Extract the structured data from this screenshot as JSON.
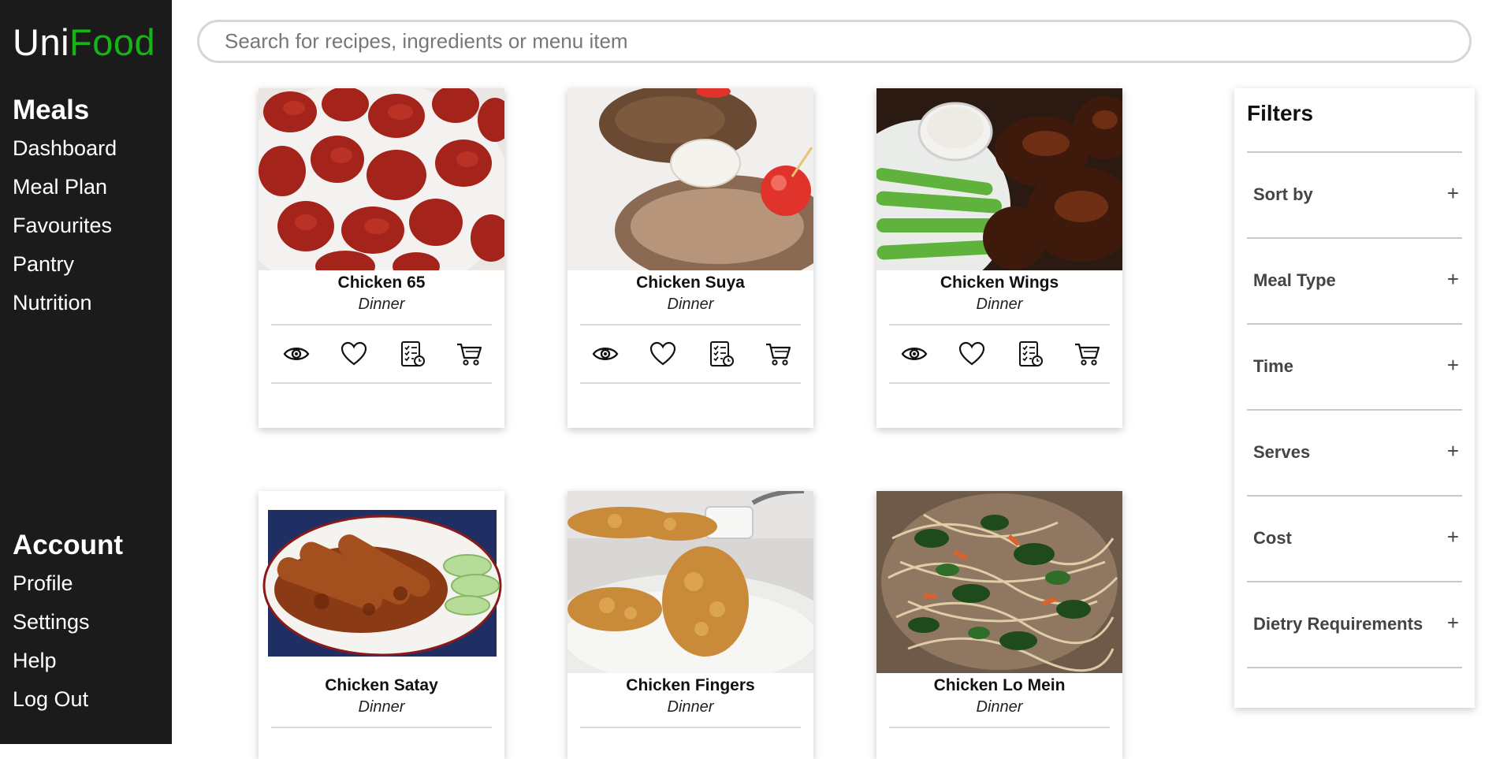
{
  "app": {
    "logo_part1": "Uni",
    "logo_part2": "Food",
    "accent_color": "#14b514"
  },
  "sidebar": {
    "meals_heading": "Meals",
    "meals_items": [
      "Dashboard",
      "Meal Plan",
      "Favourites",
      "Pantry",
      "Nutrition"
    ],
    "account_heading": "Account",
    "account_items": [
      "Profile",
      "Settings",
      "Help",
      "Log Out"
    ]
  },
  "search": {
    "placeholder": "Search for recipes, ingredients or menu item",
    "value": ""
  },
  "cards": [
    {
      "title": "Chicken 65",
      "type": "Dinner"
    },
    {
      "title": "Chicken Suya",
      "type": "Dinner"
    },
    {
      "title": "Chicken Wings",
      "type": "Dinner"
    },
    {
      "title": "Chicken Satay",
      "type": "Dinner"
    },
    {
      "title": "Chicken Fingers",
      "type": "Dinner"
    },
    {
      "title": "Chicken Lo Mein",
      "type": "Dinner"
    }
  ],
  "card_actions": [
    "eye-icon",
    "heart-icon",
    "checklist-clock-icon",
    "cart-icon"
  ],
  "filters": {
    "heading": "Filters",
    "items": [
      "Sort by",
      "Meal Type",
      "Time",
      "Serves",
      "Cost",
      "Dietry Requirements"
    ],
    "expand_symbol": "+"
  }
}
